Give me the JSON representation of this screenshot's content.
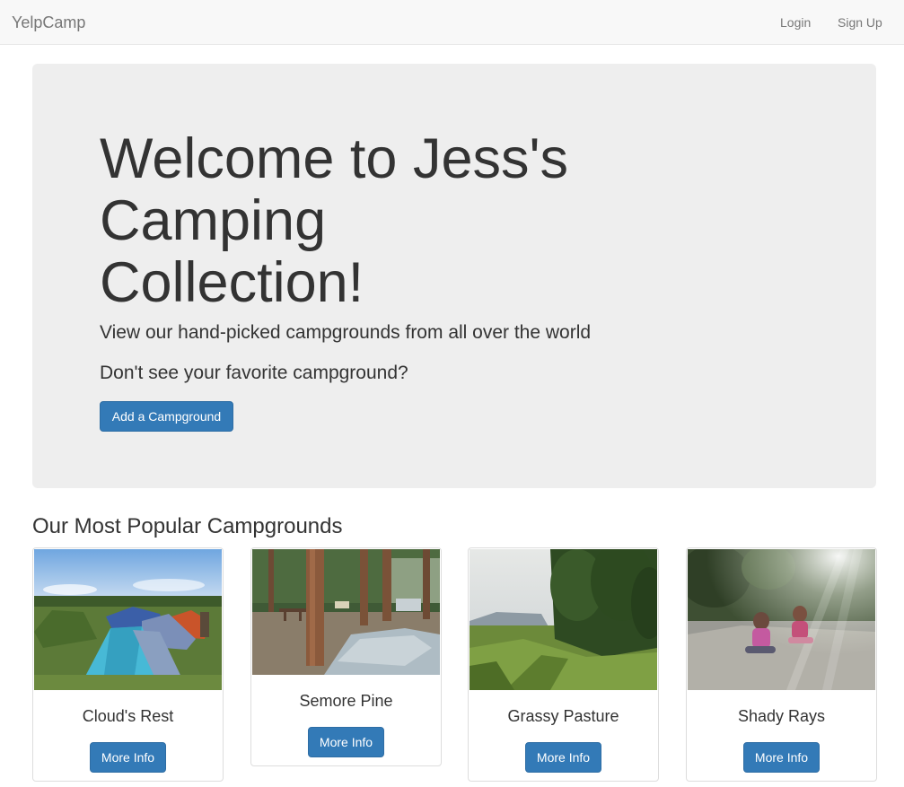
{
  "navbar": {
    "brand": "YelpCamp",
    "login": "Login",
    "signup": "Sign Up"
  },
  "hero": {
    "title": "Welcome to Jess's Camping Collection!",
    "subtitle": "View our hand-picked campgrounds from all over the world",
    "prompt": "Don't see your favorite campground?",
    "add_button": "Add a Campground"
  },
  "section_title": "Our Most Popular Campgrounds",
  "campgrounds": [
    {
      "name": "Cloud's Rest",
      "button": "More Info"
    },
    {
      "name": "Semore Pine",
      "button": "More Info"
    },
    {
      "name": "Grassy Pasture",
      "button": "More Info"
    },
    {
      "name": "Shady Rays",
      "button": "More Info"
    }
  ],
  "colors": {
    "navbar_bg": "#f8f8f8",
    "jumbotron_bg": "#eeeeee",
    "primary": "#337ab7"
  }
}
